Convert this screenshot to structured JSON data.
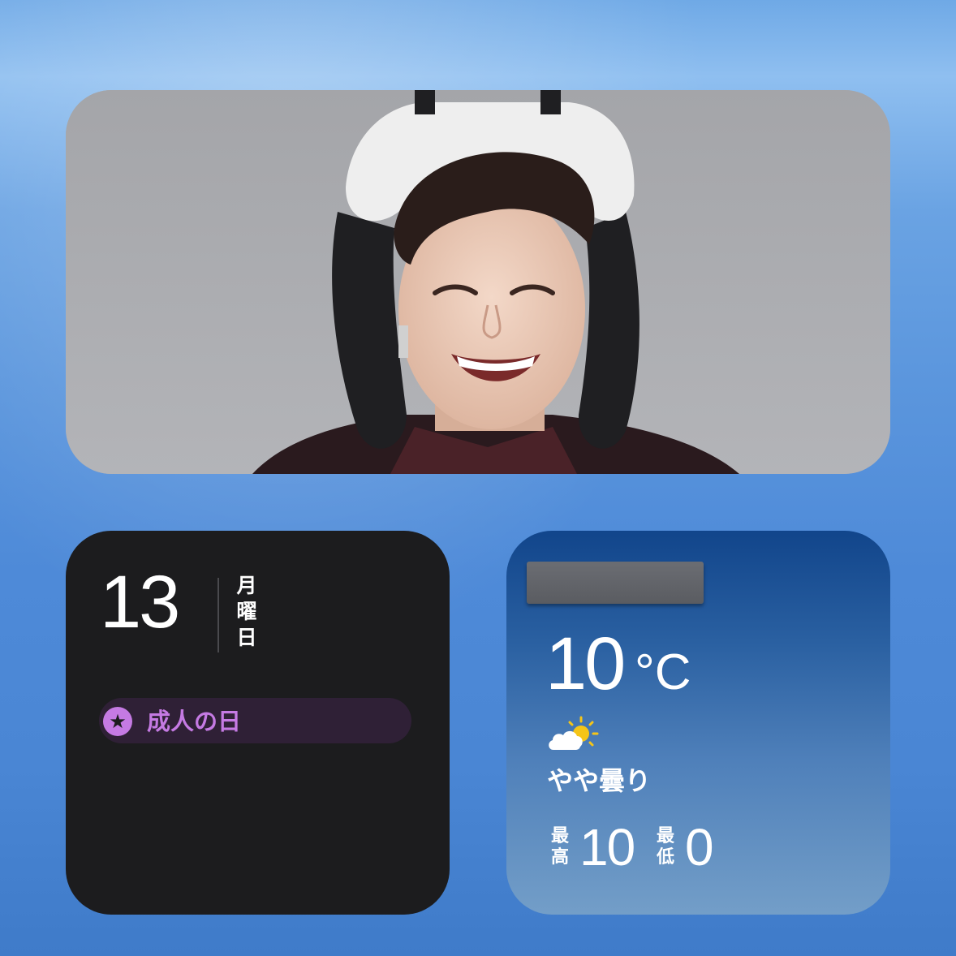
{
  "photo_widget": {
    "subject": "person-photo"
  },
  "calendar": {
    "day": "13",
    "weekday_chars": [
      "月",
      "曜",
      "日"
    ],
    "event": {
      "icon": "★",
      "label": "成人の日",
      "color": "#c57ae3"
    }
  },
  "weather": {
    "temperature": "10",
    "unit": "°C",
    "condition": "やや曇り",
    "icon": "partly-cloudy-icon",
    "high_label_chars": [
      "最",
      "高"
    ],
    "high": "10",
    "low_label_chars": [
      "最",
      "低"
    ],
    "low": "0"
  }
}
